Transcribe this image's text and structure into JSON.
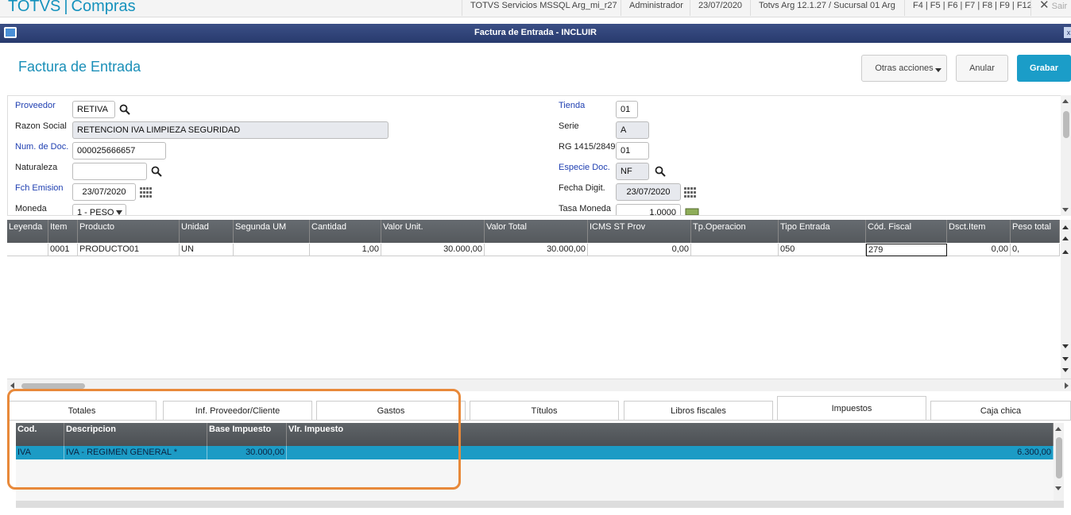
{
  "app": {
    "brand_left": "TOTVS",
    "brand_sep": "|",
    "brand_right": "Compras"
  },
  "topbar": {
    "environment": "TOTVS Servicios MSSQL Arg_mi_r27",
    "user": "Administrador",
    "date": "23/07/2020",
    "branch": "Totvs Arg 12.1.27 / Sucursal 01 Arg",
    "shortcuts": "F4 | F5 | F6 | F7 | F8 | F9 | F12",
    "exit_icon": "close-icon",
    "exit_label": "Sair"
  },
  "window": {
    "title": "Factura de Entrada - INCLUIR",
    "close": "x"
  },
  "header": {
    "title": "Factura de Entrada",
    "btn_otras": "Otras acciones",
    "btn_anular": "Anular",
    "btn_grabar": "Grabar"
  },
  "form": {
    "proveedor_label": "Proveedor",
    "proveedor_value": "RETIVA",
    "razon_label": "Razon Social",
    "razon_value": "RETENCION IVA LIMPIEZA SEGURIDAD",
    "numdoc_label": "Num. de Doc.",
    "numdoc_value": "000025666657",
    "naturaleza_label": "Naturaleza",
    "naturaleza_value": "",
    "fchemision_label": "Fch Emision",
    "fchemision_value": "23/07/2020",
    "moneda_label": "Moneda",
    "moneda_value": "1 - PESO",
    "tienda_label": "Tienda",
    "tienda_value": "01",
    "serie_label": "Serie",
    "serie_value": "A",
    "rg_label": "RG 1415/2849",
    "rg_value": "01",
    "especie_label": "Especie Doc.",
    "especie_value": "NF",
    "fechadigit_label": "Fecha Digit.",
    "fechadigit_value": "23/07/2020",
    "tasamoneda_label": "Tasa Moneda",
    "tasamoneda_value": "1,0000"
  },
  "grid": {
    "columns": [
      "Leyenda",
      "Item",
      "Producto",
      "Unidad",
      "Segunda UM",
      "Cantidad",
      "Valor Unit.",
      "Valor Total",
      "ICMS ST Prov",
      "Tp.Operacion",
      "Tipo Entrada",
      "Cód. Fiscal",
      "Dsct.Item",
      "Peso total"
    ],
    "rows": [
      [
        "",
        "0001",
        "PRODUCTO01",
        "UN",
        "",
        "1,00",
        "30.000,00",
        "30.000,00",
        "0,00",
        "",
        "050",
        "279",
        "0,00",
        "0,"
      ]
    ]
  },
  "tabs": [
    "Totales",
    "Inf. Proveedor/Cliente",
    "Gastos",
    "Títulos",
    "Libros fiscales",
    "Impuestos",
    "Caja chica"
  ],
  "active_tab": "Impuestos",
  "taxes": {
    "columns": [
      "Cod.",
      "Descripcion",
      "Base Impuesto",
      "Vlr. Impuesto"
    ],
    "rows": [
      [
        "IVA",
        "IVA - REGIMEN GENERAL *",
        "30.000,00",
        "6.300,00"
      ]
    ]
  },
  "colors": {
    "accent": "#1b9dc8",
    "highlight": "#e8893a",
    "titlebar": "#283a6d"
  }
}
